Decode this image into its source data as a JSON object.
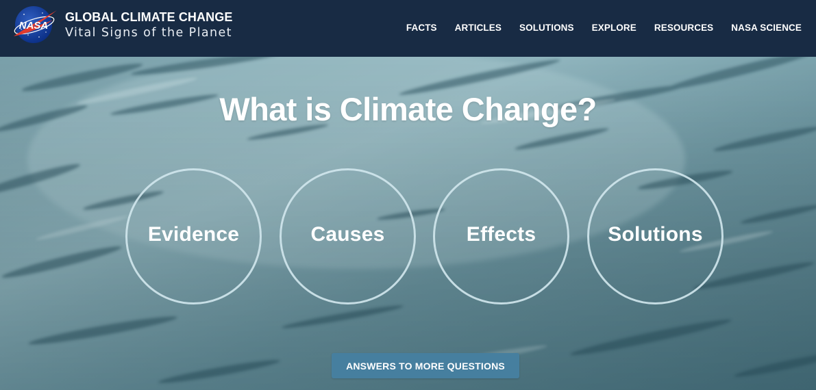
{
  "header": {
    "logo_text": "NASA",
    "title": "GLOBAL CLIMATE CHANGE",
    "subtitle": "Vital Signs of the Planet"
  },
  "nav": {
    "items": [
      {
        "label": "FACTS"
      },
      {
        "label": "ARTICLES"
      },
      {
        "label": "SOLUTIONS"
      },
      {
        "label": "EXPLORE"
      },
      {
        "label": "RESOURCES"
      },
      {
        "label": "NASA SCIENCE"
      }
    ]
  },
  "hero": {
    "title": "What is Climate Change?",
    "circles": [
      {
        "label": "Evidence"
      },
      {
        "label": "Causes"
      },
      {
        "label": "Effects"
      },
      {
        "label": "Solutions"
      }
    ],
    "button_label": "ANSWERS TO MORE QUESTIONS"
  },
  "colors": {
    "header_bg": "#182b44",
    "button_bg": "#467f9f",
    "water": "#6e98a4"
  }
}
